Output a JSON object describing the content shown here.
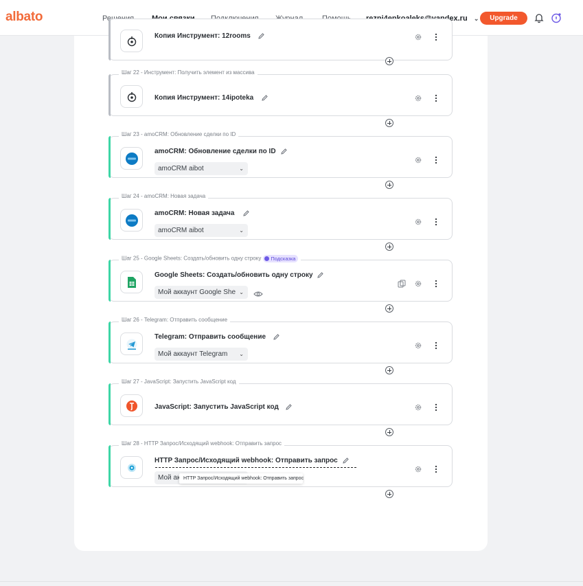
{
  "brand": {
    "logo_text": "albato",
    "accent": "#f2582d"
  },
  "nav": {
    "items": [
      "Решения",
      "Мои связки",
      "Подключения",
      "Журнал"
    ],
    "help_label": "Помощь",
    "email": "rezni4enkoaleks@yandex.ru",
    "upgrade_label": "Upgrade"
  },
  "steps": [
    {
      "label": "",
      "title": "Копия Инструмент: 12rooms",
      "icon": "tool-icon",
      "select": ""
    },
    {
      "label": "Шаг 22 - Инструмент: Получить элемент из массива",
      "title": "Копия Инструмент: 14ipoteka",
      "icon": "tool-icon",
      "select": ""
    },
    {
      "label": "Шаг 23 - amoCRM: Обновление сделки по ID",
      "title": "amoCRM: Обновление сделки по ID",
      "icon": "amocrm-icon",
      "select": "amoCRM aibot"
    },
    {
      "label": "Шаг 24 - amoCRM: Новая задача",
      "title": "amoCRM: Новая задача",
      "icon": "amocrm-icon",
      "select": "amoCRM aibot"
    },
    {
      "label": "Шаг 25 - Google Sheets: Создать/обновить одну строку",
      "hint": "Подсказка",
      "title": "Google Sheets: Создать/обновить одну строку",
      "icon": "google-sheets-icon",
      "select": "Мой аккаунт Google She"
    },
    {
      "label": "Шаг 26 - Telegram: Отправить сообщение",
      "title": "Telegram: Отправить сообщение",
      "icon": "telegram-icon",
      "select": "Мой аккаунт Telegram"
    },
    {
      "label": "Шаг 27 - JavaScript: Запустить JavaScript код",
      "title": "JavaScript: Запустить JavaScript код",
      "icon": "javascript-icon",
      "select": ""
    },
    {
      "label": "Шаг 28 - HTTP Запрос/Исходящий webhook: Отправить запрос",
      "title": "HTTP Запрос/Исходящий webhook: Отправить запрос",
      "icon": "http-webhook-icon",
      "select": "Мой ак"
    }
  ],
  "tooltip": "HTTP Запрос/Исходящий webhook: Отправить запрос"
}
